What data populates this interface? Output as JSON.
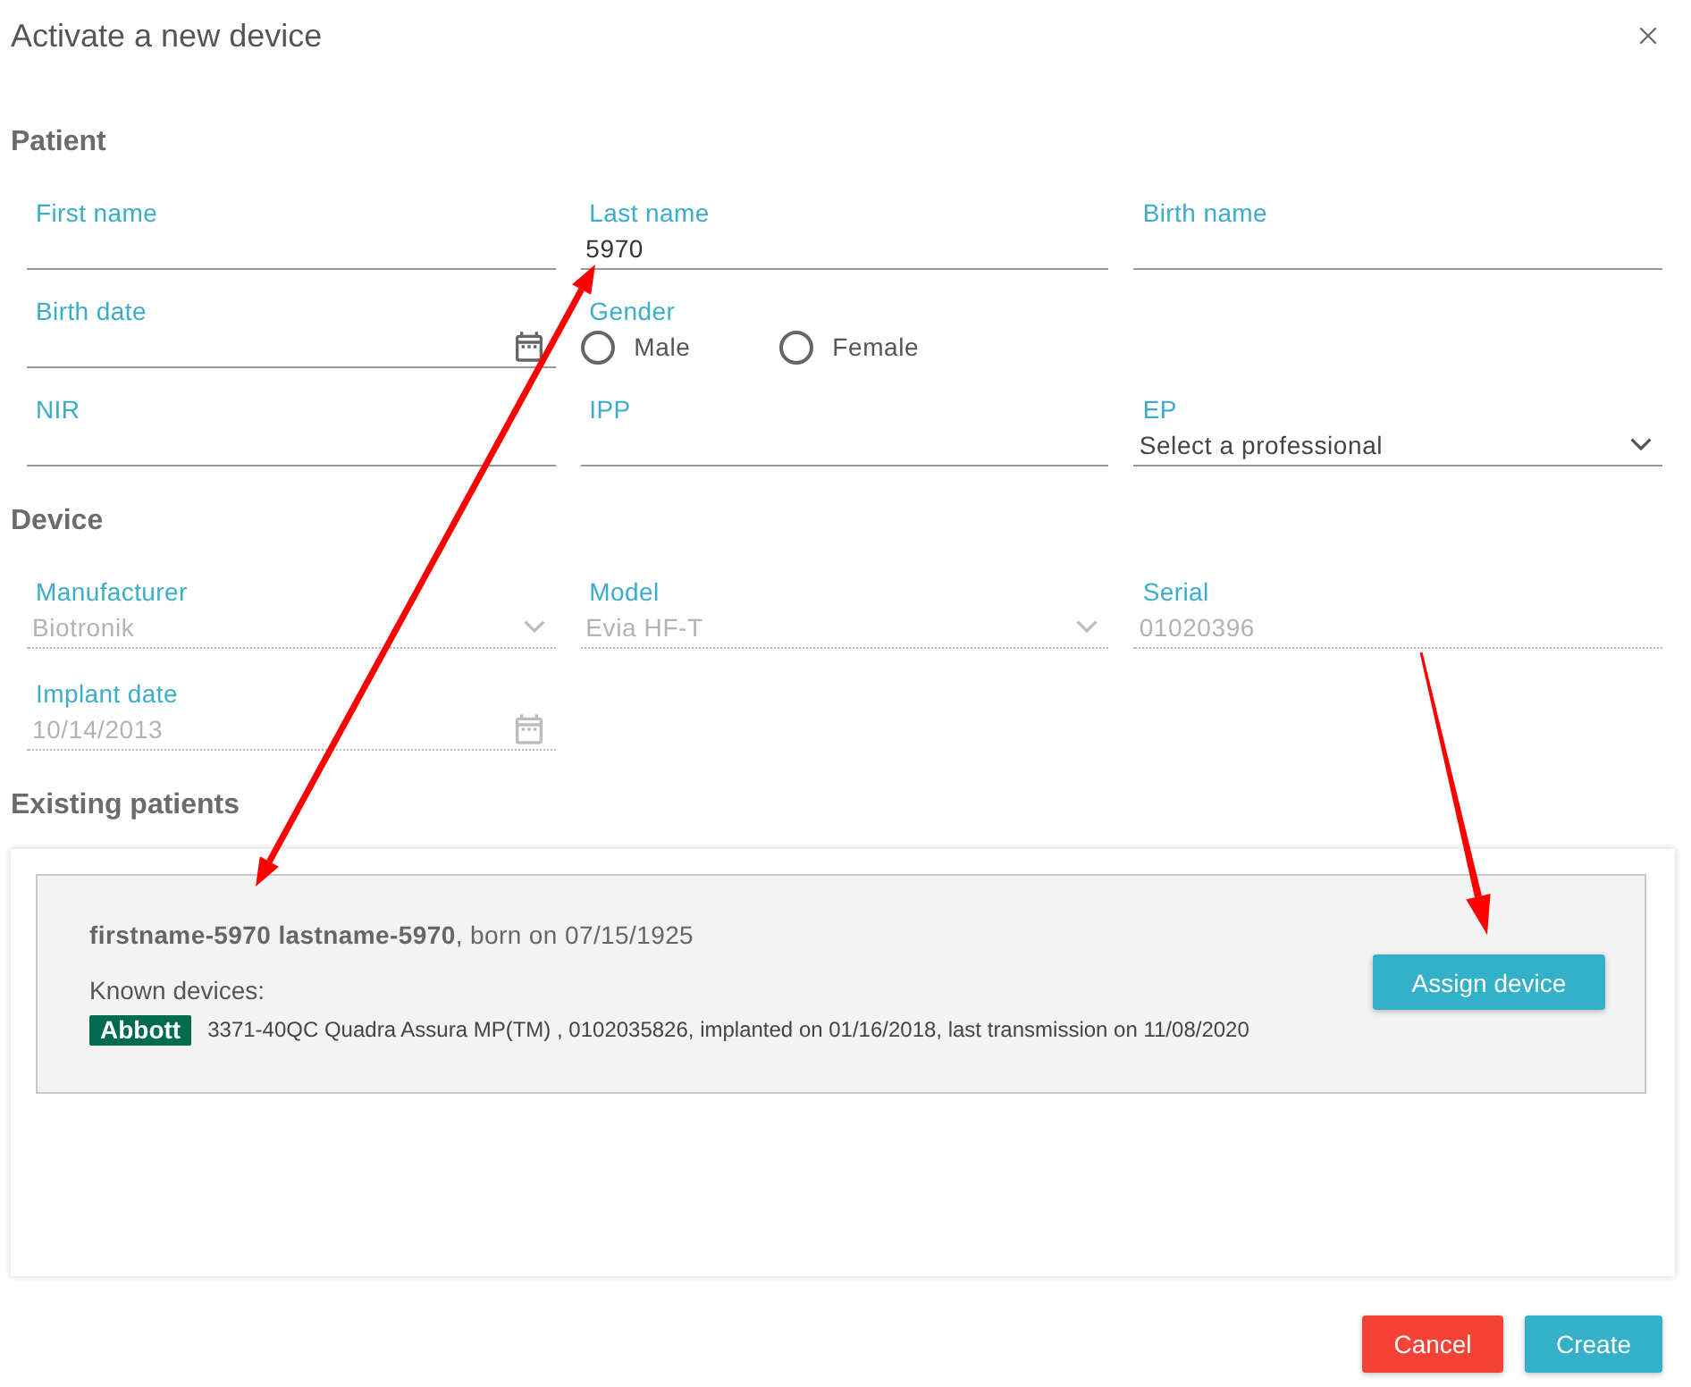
{
  "dialog": {
    "title": "Activate a new device"
  },
  "patient": {
    "heading": "Patient",
    "rows": [
      [
        {
          "kind": "text",
          "label": "First name",
          "disabled": false
        },
        {
          "kind": "text",
          "label": "Last name",
          "value": "5970",
          "disabled": false
        },
        {
          "kind": "text",
          "label": "Birth name",
          "disabled": false
        }
      ],
      [
        {
          "kind": "date",
          "label": "Birth date",
          "disabled": false
        },
        {
          "kind": "radio",
          "label": "Gender",
          "options": [
            {
              "label": "Male",
              "selected": false
            },
            {
              "label": "Female",
              "selected": false
            }
          ]
        }
      ],
      [
        {
          "kind": "text",
          "label": "NIR",
          "disabled": false
        },
        {
          "kind": "text",
          "label": "IPP",
          "disabled": false
        },
        {
          "kind": "select",
          "label": "EP",
          "placeholder": "Select a professional",
          "disabled": false
        }
      ]
    ]
  },
  "device": {
    "heading": "Device",
    "rows": [
      [
        {
          "kind": "select",
          "label": "Manufacturer",
          "value": "Biotronik",
          "disabled": true
        },
        {
          "kind": "select",
          "label": "Model",
          "value": "Evia HF-T",
          "disabled": true
        },
        {
          "kind": "text",
          "label": "Serial",
          "value": "01020396",
          "disabled": true
        }
      ],
      [
        {
          "kind": "date",
          "label": "Implant date",
          "value": "10/14/2013",
          "disabled": true
        }
      ]
    ]
  },
  "existing_patients": {
    "heading": "Existing patients",
    "results": [
      {
        "summary": "**firstname-5970 lastname-5970**, born on 07/15/1925",
        "known_devices_label": "Known devices:",
        "devices": [
          {
            "manufacturer": "Abbott",
            "details": "3371-40QC Quadra Assura MP(TM) , 0102035826, implanted on 01/16/2018, last transmission on 11/08/2020"
          }
        ],
        "action": "Assign device"
      }
    ]
  },
  "footer": {
    "buttons": [
      {
        "label": "Cancel",
        "kind": "danger"
      },
      {
        "label": "Create",
        "kind": "primary"
      }
    ]
  }
}
